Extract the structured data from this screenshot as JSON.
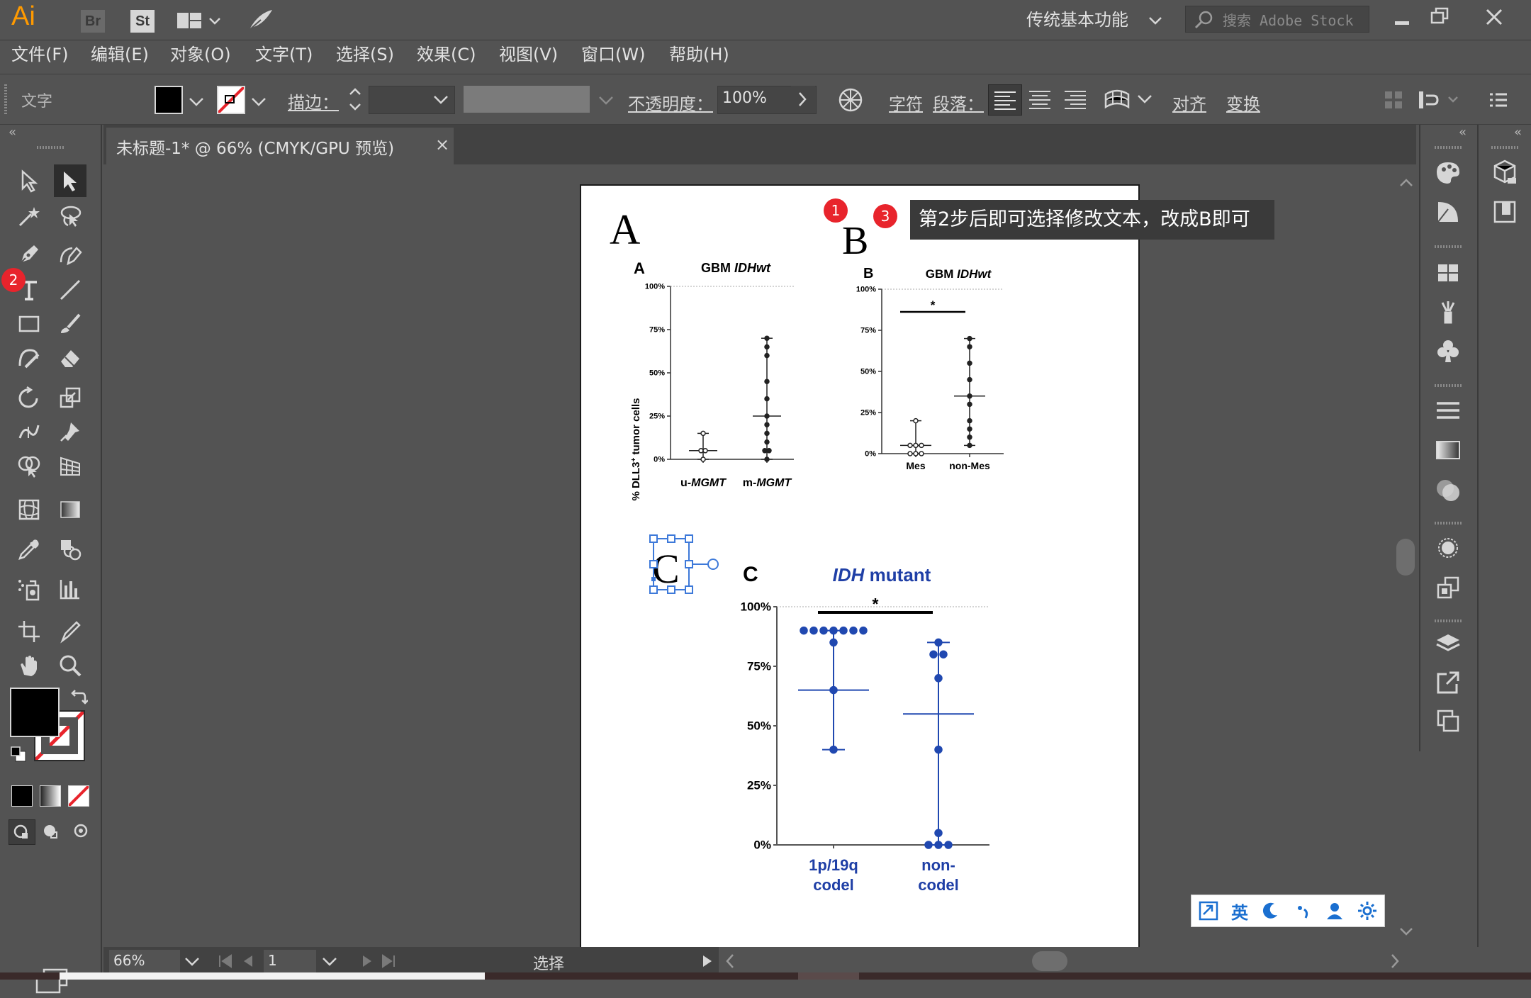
{
  "app": {
    "logo": "Ai",
    "br": "Br",
    "st": "St",
    "workspace": "传统基本功能",
    "search_placeholder": "搜索 Adobe Stock"
  },
  "menu": [
    "文件(F)",
    "编辑(E)",
    "对象(O)",
    "文字(T)",
    "选择(S)",
    "效果(C)",
    "视图(V)",
    "窗口(W)",
    "帮助(H)"
  ],
  "control": {
    "mode_label": "文字",
    "stroke_label": "描边：",
    "opacity_label": "不透明度：",
    "opacity_value": "100%",
    "char_label": "字符",
    "para_label": "段落：",
    "align_label": "对齐",
    "transform_label": "变换"
  },
  "tab": {
    "title": "未标题-1* @ 66% (CMYK/GPU 预览)",
    "close": "×"
  },
  "status": {
    "zoom": "66%",
    "page": "1",
    "mode": "选择"
  },
  "annotations": {
    "badge1": "1",
    "badge2": "2",
    "badge3": "3",
    "tooltip": "第2步后即可选择修改文本，改成B即可"
  },
  "artboard": {
    "label_a": "A",
    "label_b": "B",
    "label_c": "C"
  },
  "ime": {
    "lang": "英"
  },
  "colors": {
    "accent_blue": "#1f3fa6",
    "badge_red": "#e8242c"
  },
  "chart_data": [
    {
      "type": "scatter",
      "panel_label": "A",
      "title": "GBM IDHwt",
      "ylabel": "% DLL3+ tumor cells",
      "categories": [
        "u-MGMT",
        "m-MGMT"
      ],
      "yticks": [
        "0%",
        "25%",
        "50%",
        "75%",
        "100%"
      ],
      "ylim": [
        0,
        100
      ],
      "series": [
        {
          "values": [
            [
              0,
              0
            ],
            [
              0,
              5
            ],
            [
              0,
              5
            ],
            [
              0,
              15
            ]
          ]
        },
        {
          "values": [
            [
              1,
              0
            ],
            [
              1,
              5
            ],
            [
              1,
              5
            ],
            [
              1,
              10
            ],
            [
              1,
              15
            ],
            [
              1,
              20
            ],
            [
              1,
              25
            ],
            [
              1,
              35
            ],
            [
              1,
              45
            ],
            [
              1,
              60
            ],
            [
              1,
              65
            ],
            [
              1,
              70
            ]
          ]
        }
      ],
      "median_lines": [
        5,
        25
      ],
      "range": [
        [
          0,
          15
        ],
        [
          0,
          70
        ]
      ]
    },
    {
      "type": "scatter",
      "panel_label": "B",
      "title": "GBM IDHwt",
      "categories": [
        "Mes",
        "non-Mes"
      ],
      "yticks": [
        "0%",
        "25%",
        "50%",
        "75%",
        "100%"
      ],
      "ylim": [
        0,
        100
      ],
      "annotation": "*",
      "series": [
        {
          "values": [
            [
              0,
              0
            ],
            [
              0,
              0
            ],
            [
              0,
              0
            ],
            [
              0,
              5
            ],
            [
              0,
              5
            ],
            [
              0,
              5
            ],
            [
              0,
              20
            ]
          ]
        },
        {
          "values": [
            [
              1,
              5
            ],
            [
              1,
              10
            ],
            [
              1,
              15
            ],
            [
              1,
              20
            ],
            [
              1,
              30
            ],
            [
              1,
              35
            ],
            [
              1,
              45
            ],
            [
              1,
              55
            ],
            [
              1,
              65
            ],
            [
              1,
              70
            ]
          ]
        }
      ],
      "median_lines": [
        5,
        35
      ],
      "range": [
        [
          0,
          20
        ],
        [
          5,
          70
        ]
      ]
    },
    {
      "type": "scatter",
      "panel_label": "C",
      "title": "IDH mutant",
      "categories": [
        "1p/19q codel",
        "non-codel"
      ],
      "yticks": [
        "0%",
        "25%",
        "50%",
        "75%",
        "100%"
      ],
      "ylim": [
        0,
        100
      ],
      "annotation": "*",
      "series": [
        {
          "values": [
            [
              0,
              40
            ],
            [
              0,
              65
            ],
            [
              0,
              85
            ],
            [
              0,
              90
            ],
            [
              0,
              90
            ],
            [
              0,
              90
            ],
            [
              0,
              90
            ],
            [
              0,
              90
            ],
            [
              0,
              90
            ],
            [
              0,
              90
            ]
          ]
        },
        {
          "values": [
            [
              1,
              0
            ],
            [
              1,
              0
            ],
            [
              1,
              0
            ],
            [
              1,
              5
            ],
            [
              1,
              40
            ],
            [
              1,
              70
            ],
            [
              1,
              80
            ],
            [
              1,
              85
            ],
            [
              1,
              80
            ]
          ]
        }
      ],
      "median_lines": [
        65,
        55
      ],
      "range": [
        [
          40,
          90
        ],
        [
          0,
          85
        ]
      ]
    }
  ]
}
